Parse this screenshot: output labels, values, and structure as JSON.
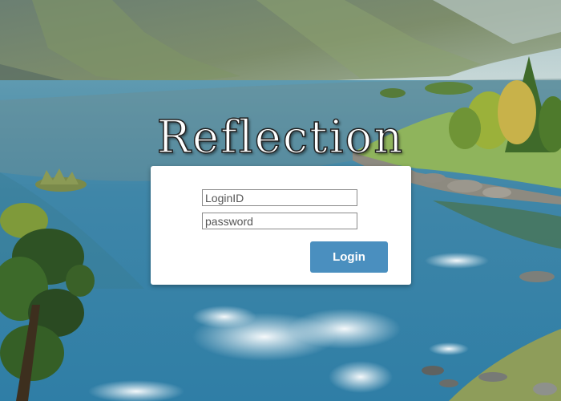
{
  "app": {
    "title": "Reflection"
  },
  "login_form": {
    "login_id_placeholder": "LoginID",
    "login_id_value": "",
    "password_placeholder": "password",
    "password_value": "",
    "submit_label": "Login"
  },
  "background": {
    "description_icon": "lake-mountain-landscape"
  },
  "colors": {
    "button_bg": "#4a8fbf",
    "card_bg": "#ffffff",
    "title_fill": "#ffffff",
    "title_outline": "#222222"
  }
}
